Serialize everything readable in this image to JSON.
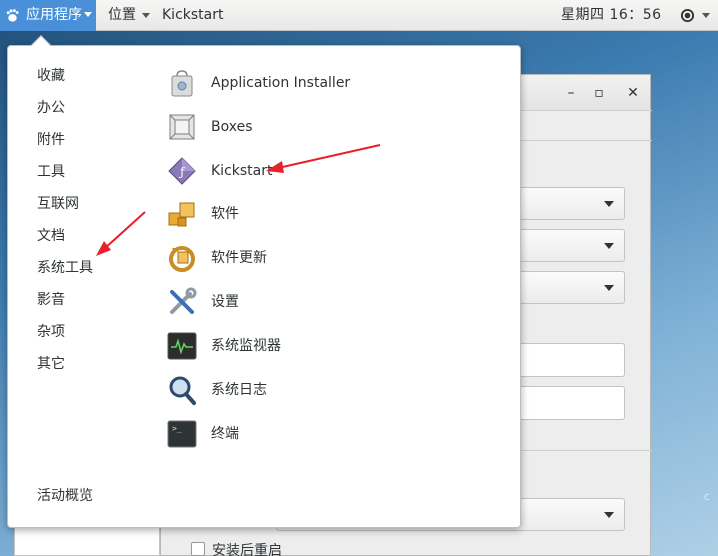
{
  "topbar": {
    "applications_label": "应用程序",
    "places_label": "位置",
    "active_app": "Kickstart",
    "clock": "星期四 16：56"
  },
  "window": {
    "min_glyph": "–",
    "max_glyph": "▫",
    "close_glyph": "✕",
    "checkbox_label": "安装后重启",
    "edge_char": "c"
  },
  "menu": {
    "categories": [
      "收藏",
      "办公",
      "附件",
      "工具",
      "互联网",
      "文档",
      "系统工具",
      "影音",
      "杂项",
      "其它"
    ],
    "activities_overview": "活动概览",
    "apps": [
      {
        "label": "Application Installer",
        "icon": "software-installer-icon"
      },
      {
        "label": "Boxes",
        "icon": "boxes-icon"
      },
      {
        "label": "Kickstart",
        "icon": "kickstart-icon"
      },
      {
        "label": "软件",
        "icon": "software-package-icon"
      },
      {
        "label": "软件更新",
        "icon": "software-update-icon"
      },
      {
        "label": "设置",
        "icon": "settings-tools-icon"
      },
      {
        "label": "系统监视器",
        "icon": "system-monitor-icon"
      },
      {
        "label": "系统日志",
        "icon": "system-log-icon"
      },
      {
        "label": "终端",
        "icon": "terminal-icon"
      }
    ]
  },
  "colors": {
    "topbar_active": "#4a90d9",
    "annotation_arrow": "#e8202a",
    "menu_bg": "#ffffff"
  }
}
